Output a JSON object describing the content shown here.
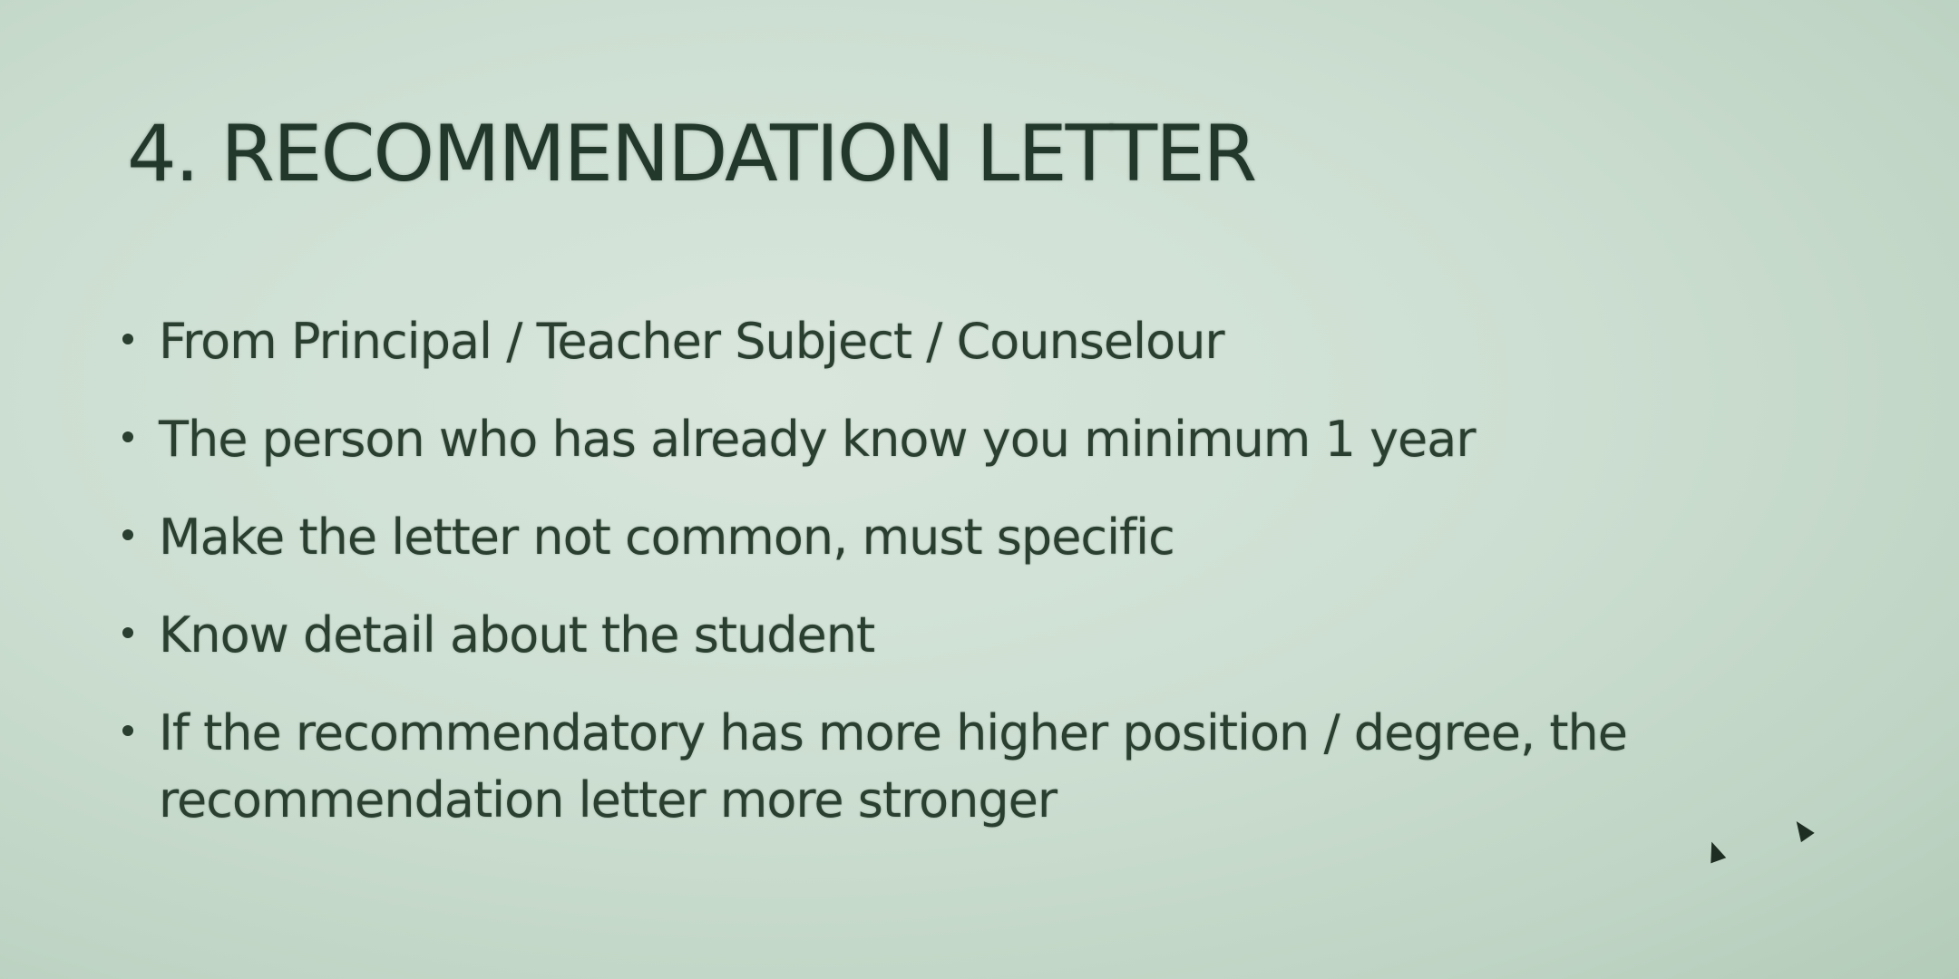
{
  "slide": {
    "title": "4.  RECOMMENDATION LETTER",
    "bullets": [
      "From Principal / Teacher Subject / Counselour",
      "The person who has already know you minimum 1 year",
      "Make the letter not common, must specific",
      "Know detail about the student",
      "If the recommendatory has more higher position / degree, the recommendation letter more stronger"
    ]
  }
}
